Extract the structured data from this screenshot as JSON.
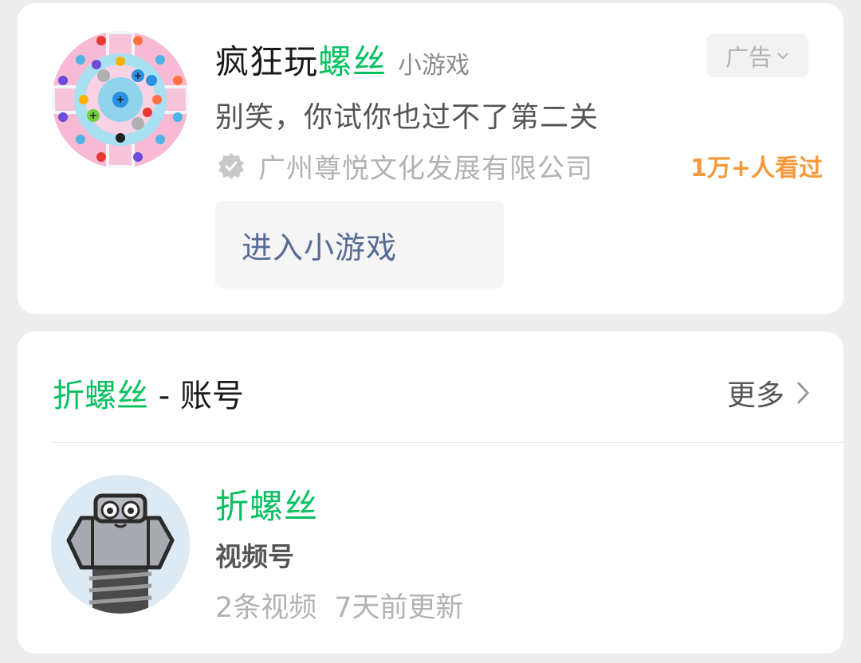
{
  "ad": {
    "title_prefix": "疯狂玩",
    "title_highlight": "螺丝",
    "tag": "小游戏",
    "badge": "广告",
    "description": "别笑，你试你也过不了第二关",
    "company": "广州尊悦文化发展有限公司",
    "views": "1万+人看过",
    "button_label": "进入小游戏"
  },
  "account": {
    "section_highlight": "折螺丝",
    "section_suffix": " - 账号",
    "more_label": "更多",
    "name": "折螺丝",
    "type": "视频号",
    "video_count": "2条视频",
    "updated": "7天前更新"
  },
  "colors": {
    "accent_green": "#07c160",
    "link_blue": "#576b95",
    "views_orange": "#f59a3c",
    "card_bg": "#ffffff",
    "page_bg": "#ededed"
  },
  "icons": {
    "badge_dropdown": "chevron-down-icon",
    "verified": "verified-check-icon",
    "more": "chevron-right-icon"
  }
}
